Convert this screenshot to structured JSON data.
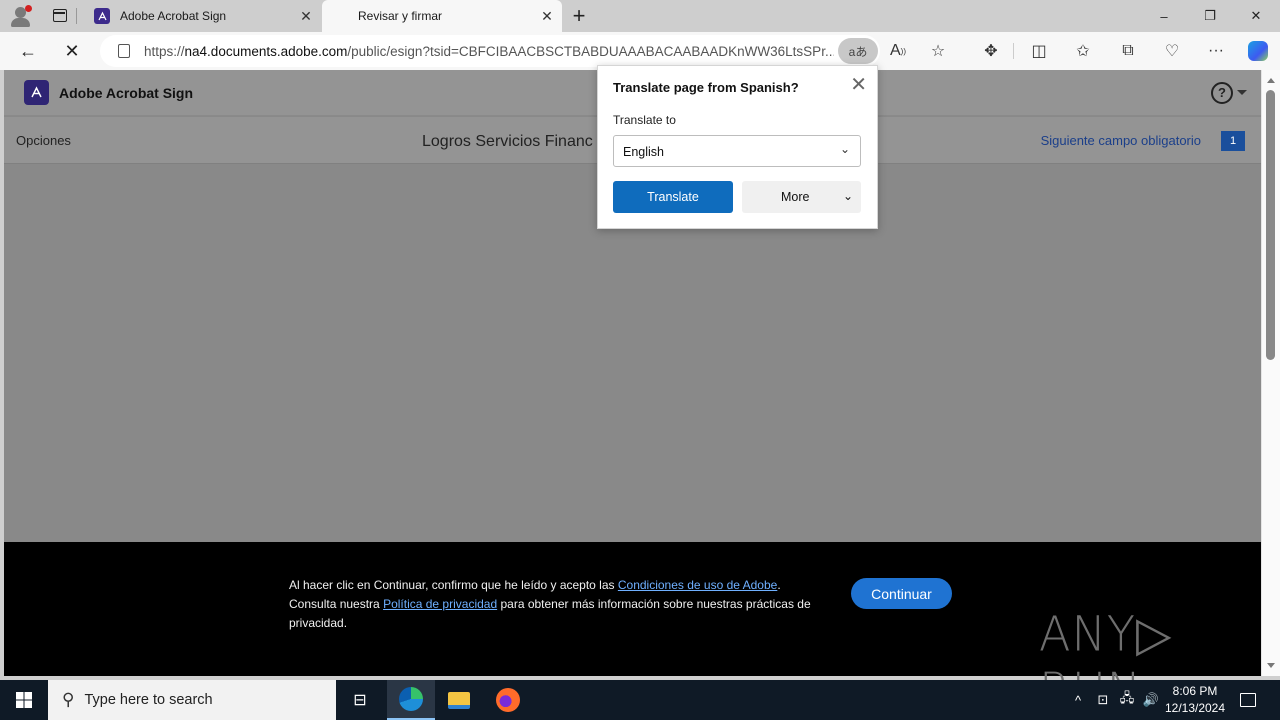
{
  "browser": {
    "tabs": [
      {
        "label": "Adobe Acrobat Sign",
        "active": false
      },
      {
        "label": "Revisar y firmar",
        "active": true
      }
    ],
    "new_tab_icon": "plus-icon",
    "window_controls": {
      "minimize": "–",
      "restore": "❐",
      "close": "✕"
    },
    "url": {
      "prefix": "https://",
      "host": "na4.documents.adobe.com",
      "path": "/public/esign?tsid=CBFCIBAACBSCTBABDUAAABACAABAADKnWW36LtsSPr..."
    },
    "translate_badge": "aあ"
  },
  "app": {
    "brand": "Adobe Acrobat Sign",
    "options_label": "Opciones",
    "document_title": "Logros Servicios Financ",
    "next_required_label": "Siguiente campo obligatorio",
    "next_required_count": "1",
    "help_label": "?"
  },
  "consent": {
    "line1_prefix": "Al hacer clic en Continuar, confirmo que he leído y acepto las ",
    "terms_link": "Condiciones de uso de Adobe",
    "line1_suffix": ".",
    "line2_prefix": "Consulta nuestra ",
    "privacy_link": "Política de privacidad",
    "line2_suffix": " para obtener más información sobre nuestras prácticas de privacidad.",
    "continue_button": "Continuar"
  },
  "translate_popup": {
    "title": "Translate page from Spanish?",
    "translate_to_label": "Translate to",
    "selected_language": "English",
    "translate_button": "Translate",
    "more_button": "More"
  },
  "watermark": {
    "left": "ANY",
    "right": "RUN"
  },
  "taskbar": {
    "search_placeholder": "Type here to search",
    "time": "8:06 PM",
    "date": "12/13/2024"
  },
  "colors": {
    "accent_blue": "#0f6cbd",
    "continue_blue": "#1f73d2",
    "acrobat_purple": "#2f2574",
    "link_blue": "#6fb0ff"
  }
}
